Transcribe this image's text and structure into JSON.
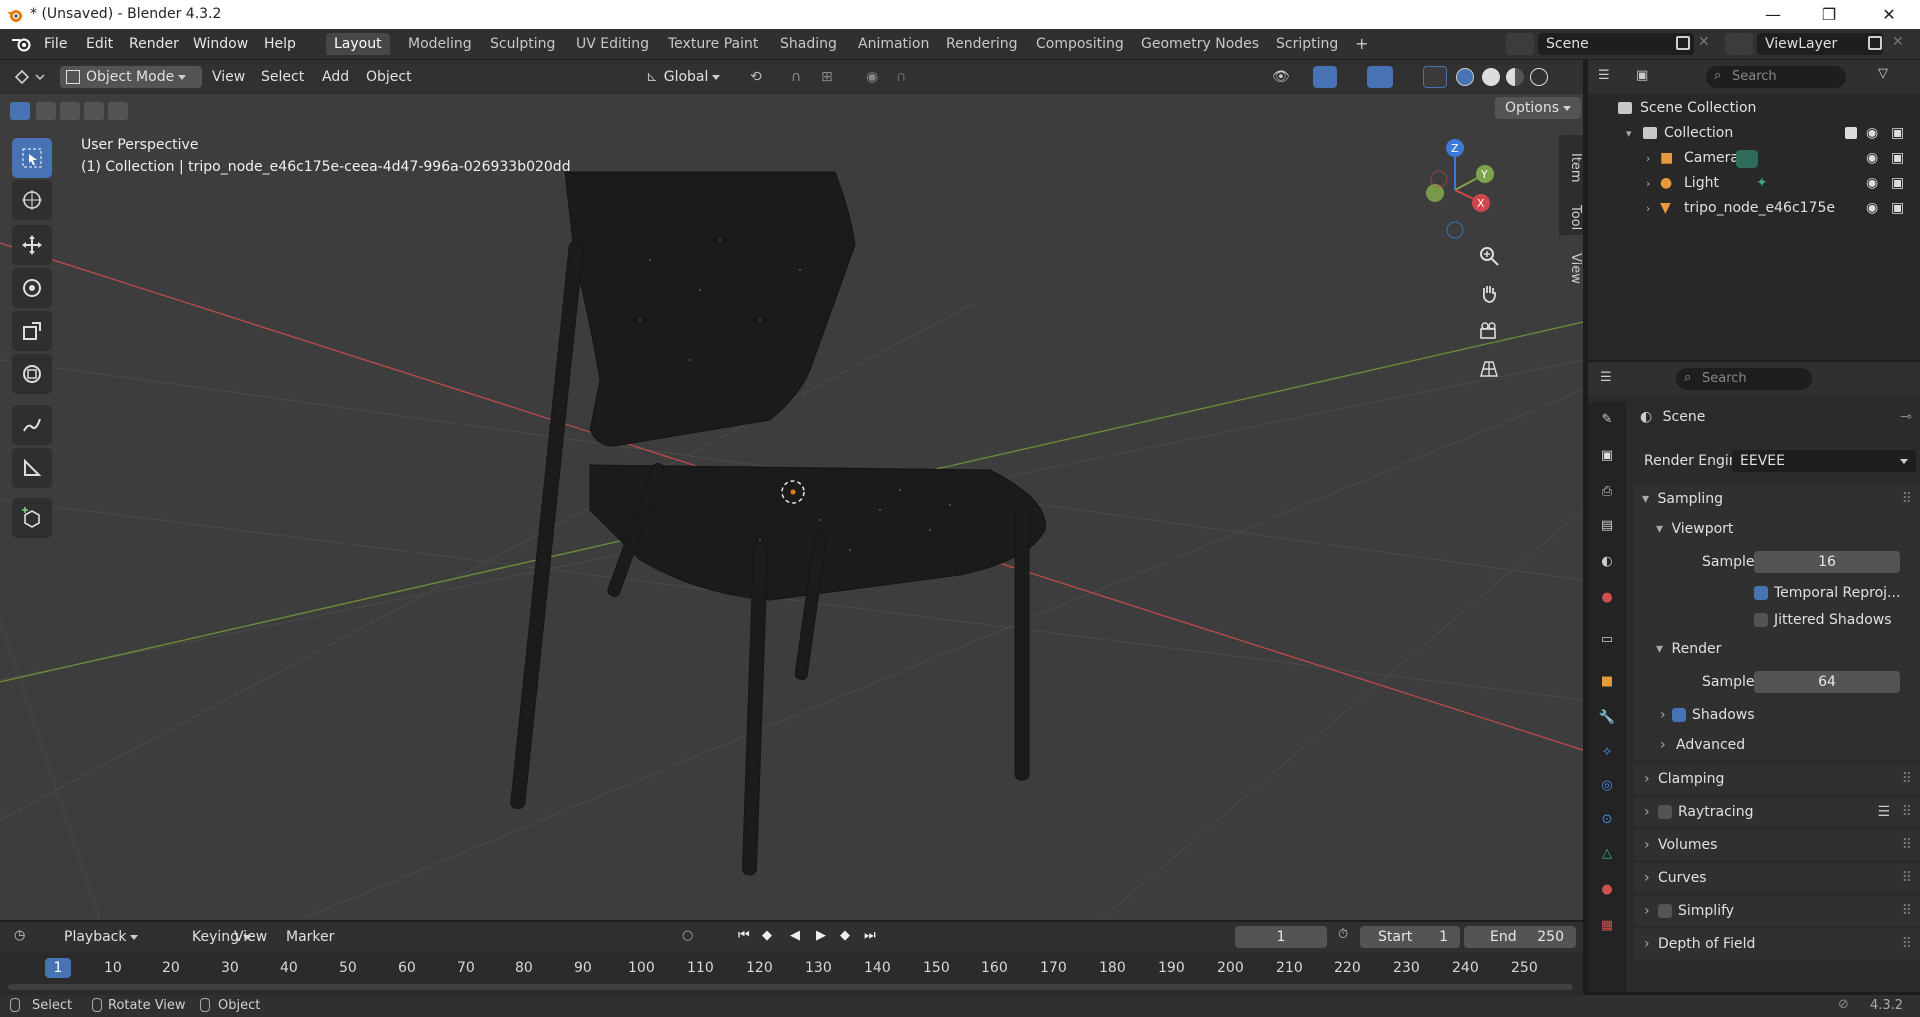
{
  "window": {
    "title": "* (Unsaved) - Blender 4.3.2",
    "minimize": "—",
    "maximize": "❐",
    "close": "✕"
  },
  "menu": {
    "items": [
      "File",
      "Edit",
      "Render",
      "Window",
      "Help"
    ]
  },
  "workspaces": {
    "tabs": [
      "Layout",
      "Modeling",
      "Sculpting",
      "UV Editing",
      "Texture Paint",
      "Shading",
      "Animation",
      "Rendering",
      "Compositing",
      "Geometry Nodes",
      "Scripting"
    ],
    "active": "Layout",
    "add": "+"
  },
  "scene_selector": {
    "value": "Scene"
  },
  "viewlayer_selector": {
    "value": "ViewLayer"
  },
  "viewport": {
    "mode": "Object Mode",
    "menus": [
      "View",
      "Select",
      "Add",
      "Object"
    ],
    "orientation": "Global",
    "options": "Options",
    "overlay_title": "User Perspective",
    "overlay_subtitle": "(1) Collection | tripo_node_e46c175e-ceea-4d47-996a-026933b020dd",
    "tabs": [
      "Item",
      "Tool",
      "View"
    ],
    "gizmo": {
      "x": "X",
      "y": "Y",
      "z": "Z"
    }
  },
  "outliner": {
    "search_placeholder": "Search",
    "scene_collection": "Scene Collection",
    "collection": "Collection",
    "items": [
      "Camera",
      "Light",
      "tripo_node_e46c175e"
    ]
  },
  "properties": {
    "search_placeholder": "Search",
    "context": "Scene",
    "render_engine_label": "Render Engine",
    "render_engine_value": "EEVEE",
    "sampling": "Sampling",
    "viewport_section": "Viewport",
    "viewport_samples_label": "Samples",
    "viewport_samples": "16",
    "temporal_reprojection": "Temporal Reproj...",
    "jittered_shadows": "Jittered Shadows",
    "render_section": "Render",
    "render_samples_label": "Samples",
    "render_samples": "64",
    "shadows": "Shadows",
    "advanced": "Advanced",
    "panels": [
      "Clamping",
      "Raytracing",
      "Volumes",
      "Curves",
      "Simplify",
      "Depth of Field"
    ]
  },
  "timeline": {
    "menus": [
      "Playback",
      "Keying",
      "View",
      "Marker"
    ],
    "current_frame": "1",
    "start_label": "Start",
    "start_value": "1",
    "end_label": "End",
    "end_value": "250",
    "ruler": [
      "1",
      "10",
      "20",
      "30",
      "40",
      "50",
      "60",
      "70",
      "80",
      "90",
      "100",
      "110",
      "120",
      "130",
      "140",
      "150",
      "160",
      "170",
      "180",
      "190",
      "200",
      "210",
      "220",
      "230",
      "240",
      "250"
    ]
  },
  "statusbar": {
    "select": "Select",
    "rotate": "Rotate View",
    "object": "Object",
    "version": "4.3.2"
  },
  "colors": {
    "accent": "#4772b3",
    "x_axis": "#d0464f",
    "y_axis": "#7ea34a",
    "z_axis": "#3c7ad8"
  }
}
